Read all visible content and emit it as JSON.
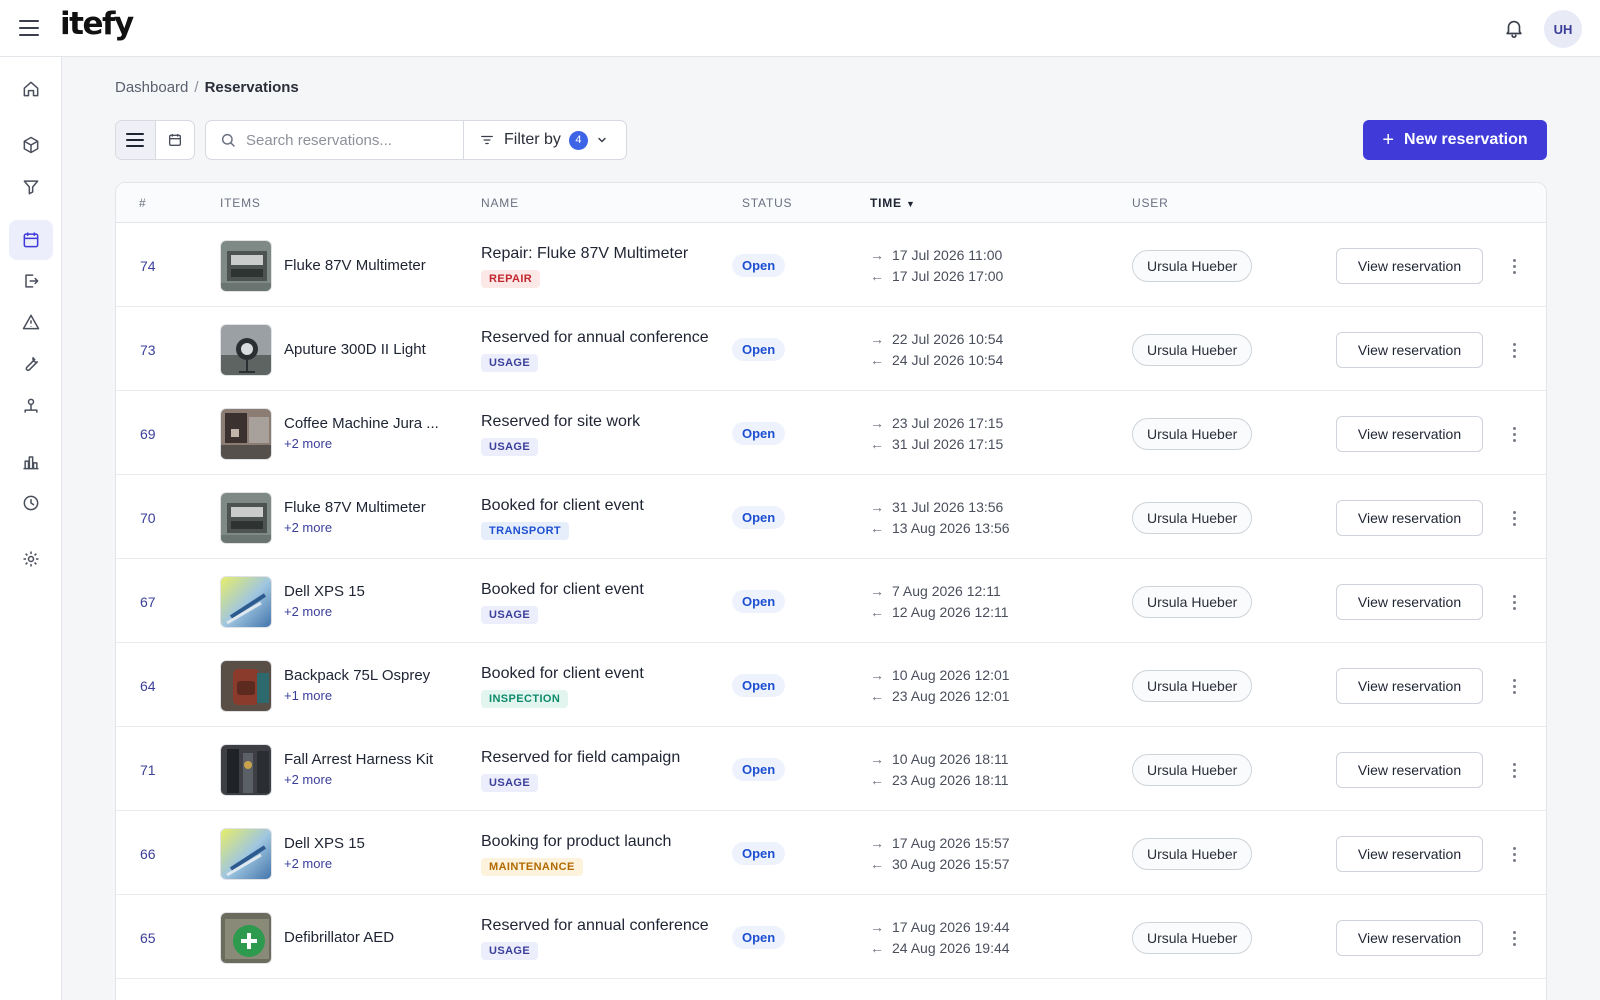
{
  "app": {
    "logo": "itefy",
    "user_initials": "UH"
  },
  "sidebar": {
    "items": [
      "home-icon",
      "box-icon",
      "funnel-icon",
      "calendar-icon",
      "checkout-icon",
      "warning-icon",
      "wrench-icon",
      "team-icon",
      "bar-chart-icon",
      "history-icon",
      "settings-icon"
    ],
    "active": "calendar-icon"
  },
  "breadcrumb": {
    "root": "Dashboard",
    "separator": "/",
    "current": "Reservations"
  },
  "toolbar": {
    "search_placeholder": "Search reservations...",
    "filter_label": "Filter by",
    "filter_count": "4",
    "new_button": "New reservation"
  },
  "table": {
    "headers": {
      "id": "#",
      "items": "ITEMS",
      "name": "NAME",
      "status": "STATUS",
      "time": "TIME",
      "user": "USER"
    },
    "sort_column": "TIME",
    "sort_direction": "descending-arrow",
    "rows": [
      {
        "id": "74",
        "item": "Fluke 87V Multimeter",
        "more": "",
        "thumb": "multimeter",
        "name": "Repair: Fluke 87V Multimeter",
        "tag": "REPAIR",
        "status": "Open",
        "start": "17 Jul 2026 11:00",
        "end": "17 Jul 2026 17:00",
        "user": "Ursula Hueber",
        "action": "View reservation"
      },
      {
        "id": "73",
        "item": "Aputure 300D II Light",
        "more": "",
        "thumb": "light",
        "name": "Reserved for annual conference",
        "tag": "USAGE",
        "status": "Open",
        "start": "22 Jul 2026 10:54",
        "end": "24 Jul 2026 10:54",
        "user": "Ursula Hueber",
        "action": "View reservation"
      },
      {
        "id": "69",
        "item": "Coffee Machine Jura ...",
        "more": "+2 more",
        "thumb": "coffee",
        "name": "Reserved for site work",
        "tag": "USAGE",
        "status": "Open",
        "start": "23 Jul 2026 17:15",
        "end": "31 Jul 2026 17:15",
        "user": "Ursula Hueber",
        "action": "View reservation"
      },
      {
        "id": "70",
        "item": "Fluke 87V Multimeter",
        "more": "+2 more",
        "thumb": "multimeter",
        "name": "Booked for client event",
        "tag": "TRANSPORT",
        "status": "Open",
        "start": "31 Jul 2026 13:56",
        "end": "13 Aug 2026 13:56",
        "user": "Ursula Hueber",
        "action": "View reservation"
      },
      {
        "id": "67",
        "item": "Dell XPS 15",
        "more": "+2 more",
        "thumb": "laptop",
        "name": "Booked for client event",
        "tag": "USAGE",
        "status": "Open",
        "start": "7 Aug 2026 12:11",
        "end": "12 Aug 2026 12:11",
        "user": "Ursula Hueber",
        "action": "View reservation"
      },
      {
        "id": "64",
        "item": "Backpack 75L Osprey",
        "more": "+1 more",
        "thumb": "backpack",
        "name": "Booked for client event",
        "tag": "INSPECTION",
        "status": "Open",
        "start": "10 Aug 2026 12:01",
        "end": "23 Aug 2026 12:01",
        "user": "Ursula Hueber",
        "action": "View reservation"
      },
      {
        "id": "71",
        "item": "Fall Arrest Harness Kit",
        "more": "+2 more",
        "thumb": "harness",
        "name": "Reserved for field campaign",
        "tag": "USAGE",
        "status": "Open",
        "start": "10 Aug 2026 18:11",
        "end": "23 Aug 2026 18:11",
        "user": "Ursula Hueber",
        "action": "View reservation"
      },
      {
        "id": "66",
        "item": "Dell XPS 15",
        "more": "+2 more",
        "thumb": "laptop",
        "name": "Booking for product launch",
        "tag": "MAINTENANCE",
        "status": "Open",
        "start": "17 Aug 2026 15:57",
        "end": "30 Aug 2026 15:57",
        "user": "Ursula Hueber",
        "action": "View reservation"
      },
      {
        "id": "65",
        "item": "Defibrillator AED",
        "more": "",
        "thumb": "aed",
        "name": "Reserved for annual conference",
        "tag": "USAGE",
        "status": "Open",
        "start": "17 Aug 2026 19:44",
        "end": "24 Aug 2026 19:44",
        "user": "Ursula Hueber",
        "action": "View reservation"
      }
    ]
  },
  "colors": {
    "accent": "#3f3ad8",
    "status_open": "#1e4fd0",
    "tag_REPAIR": "#c0262d",
    "tag_USAGE": "#3b3f9a",
    "tag_TRANSPORT": "#1e4fd0",
    "tag_INSPECTION": "#0f8a6a",
    "tag_MAINTENANCE": "#b26a00"
  }
}
